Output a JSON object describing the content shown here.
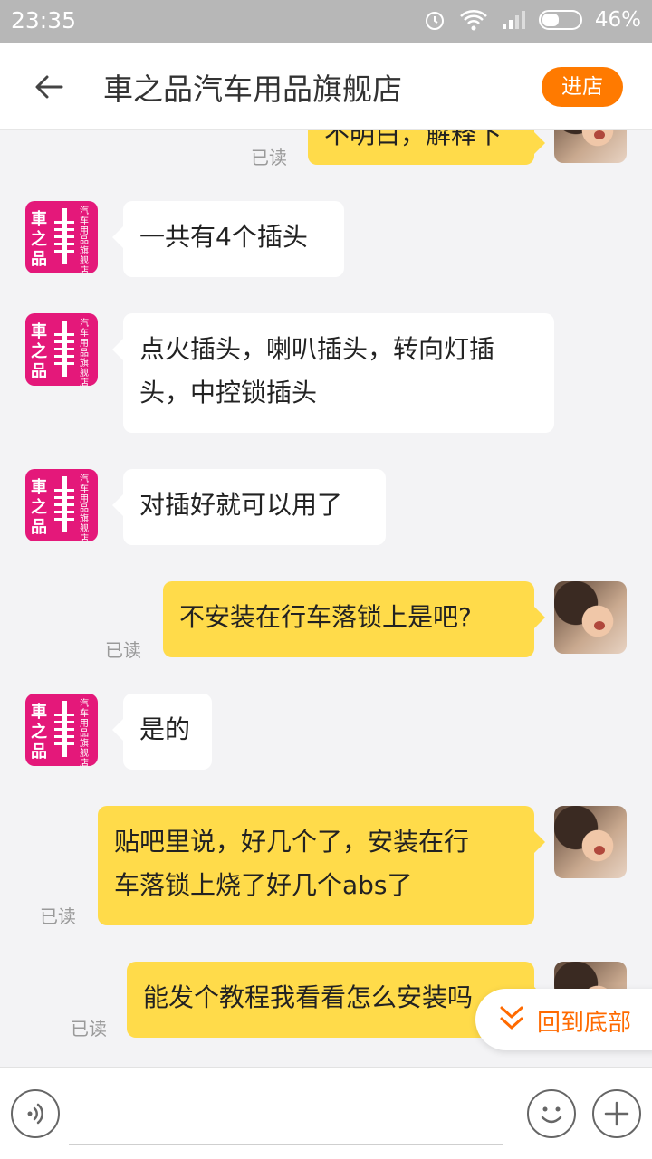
{
  "status": {
    "time": "23:35",
    "battery": "46%"
  },
  "header": {
    "title": "車之品汽车用品旗舰店",
    "enter_label": "进店"
  },
  "shop_avatar": {
    "big_text": "車之品",
    "small_text": "汽车用品旗舰店"
  },
  "messages": [
    {
      "side": "right",
      "text": "不明白，解释下",
      "read": "已读"
    },
    {
      "side": "left",
      "text": "一共有4个插头"
    },
    {
      "side": "left",
      "line1": "点火插头，喇叭插头，转向灯插",
      "line2": "头，中控锁插头"
    },
    {
      "side": "left",
      "text": "对插好就可以用了"
    },
    {
      "side": "right",
      "text": "不安装在行车落锁上是吧?",
      "read": "已读"
    },
    {
      "side": "left",
      "text": "是的"
    },
    {
      "side": "right",
      "line1": "贴吧里说，好几个了，安装在行",
      "line2": "车落锁上烧了好几个abs了",
      "read": "已读"
    },
    {
      "side": "right",
      "text": "能发个教程我看看怎么安装吗",
      "read": "已读"
    }
  ],
  "back_to_bottom": "回到底部",
  "colors": {
    "accent": "#ff7a00",
    "bubble_right": "#ffdb4a",
    "shop_avatar": "#e4187a"
  }
}
